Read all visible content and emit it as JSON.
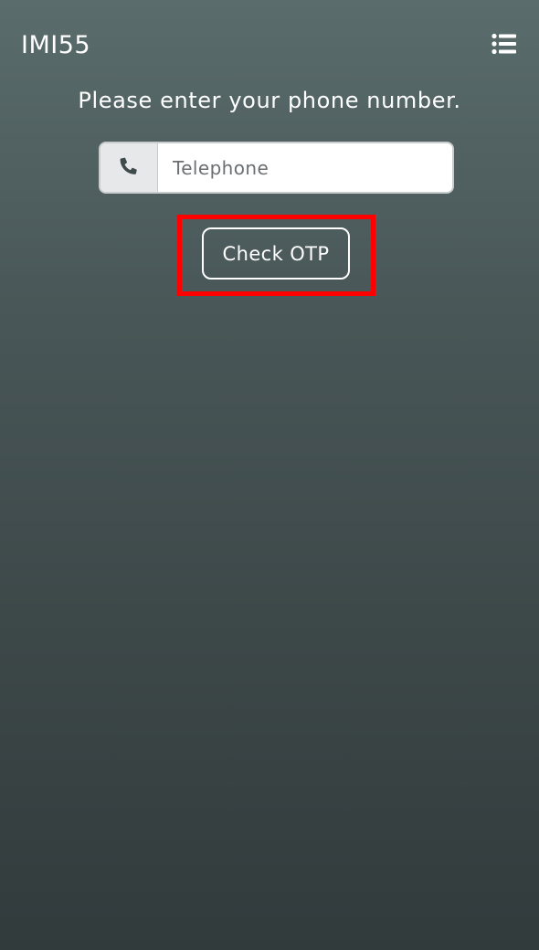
{
  "header": {
    "app_title": "IMI55",
    "menu_icon": "list-icon"
  },
  "form": {
    "prompt": "Please enter your phone number.",
    "phone_icon": "phone-icon",
    "phone_placeholder": "Telephone",
    "phone_value": "",
    "submit_label": "Check OTP"
  },
  "colors": {
    "background_top": "#5a6c6c",
    "background_bottom": "#323b3c",
    "highlight": "#ff0000",
    "text": "#ffffff"
  }
}
